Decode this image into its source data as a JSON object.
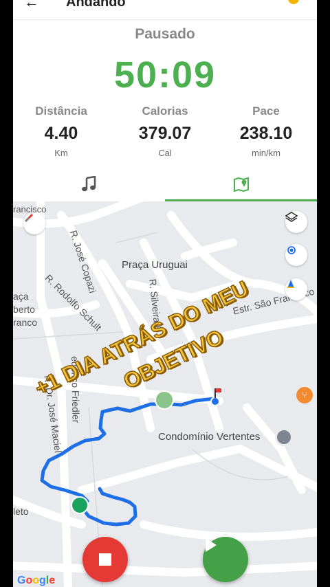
{
  "header": {
    "title": "Andando"
  },
  "status": "Pausado",
  "timer": "50:09",
  "stats": [
    {
      "label": "Distância",
      "value": "4.40",
      "unit": "Km"
    },
    {
      "label": "Calorias",
      "value": "379.07",
      "unit": "Cal"
    },
    {
      "label": "Pace",
      "value": "238.10",
      "unit": "min/km"
    }
  ],
  "tabs": [
    {
      "icon": "music-note-icon",
      "active": false
    },
    {
      "icon": "map-icon",
      "active": true
    }
  ],
  "map": {
    "streets": {
      "francisco": "rancisco",
      "jose_copazi": "R. José Copazi",
      "praca_uruguai": "Praça Uruguai",
      "rodolfo": "R. Rodolfo Schult",
      "silveira": "R. Silveira K",
      "aca": "aça",
      "berto": "berto",
      "franco": "ranco",
      "estr_sao_francisco": "Estr. São Francisco",
      "jose_maciel": "R. Dr. José Maciel",
      "frederico": "ederico Friedler",
      "condominio": "Condomínio Vertentes",
      "leto": "leto"
    },
    "overlay_line1": "+1 DIA ATRÁS DO MEU",
    "overlay_line2": "OBJETIVO",
    "attribution": "Google"
  },
  "controls": {
    "stop_color": "#e53935",
    "play_color": "#43a047"
  },
  "colors": {
    "accent": "#4caf50",
    "route": "#1e6fe6"
  }
}
